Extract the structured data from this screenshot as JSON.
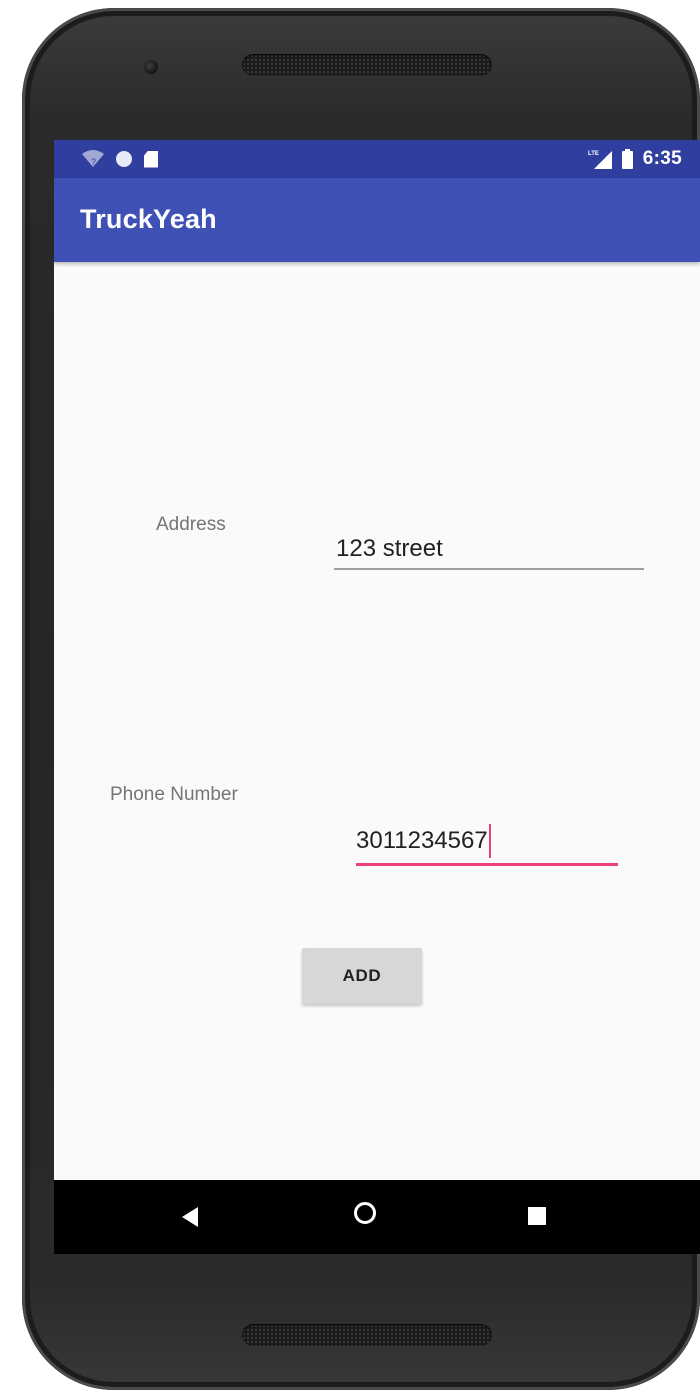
{
  "status_bar": {
    "time": "6:35",
    "icons": [
      "wifi-icon",
      "notification-dot-icon",
      "sd-card-icon",
      "lte-signal-icon",
      "battery-icon"
    ]
  },
  "app_bar": {
    "title": "TruckYeah"
  },
  "form": {
    "address_label": "Address",
    "address_value": "123 street",
    "phone_label": "Phone Number",
    "phone_value": "3011234567",
    "add_button_label": "ADD"
  },
  "nav_bar": {
    "icons": [
      "back-icon",
      "home-icon",
      "recents-icon"
    ]
  },
  "colors": {
    "status_bar": "#303f9f",
    "app_bar": "#3f51b5",
    "accent": "#ec407a",
    "background": "#fafafa",
    "button": "#d6d7d7"
  }
}
